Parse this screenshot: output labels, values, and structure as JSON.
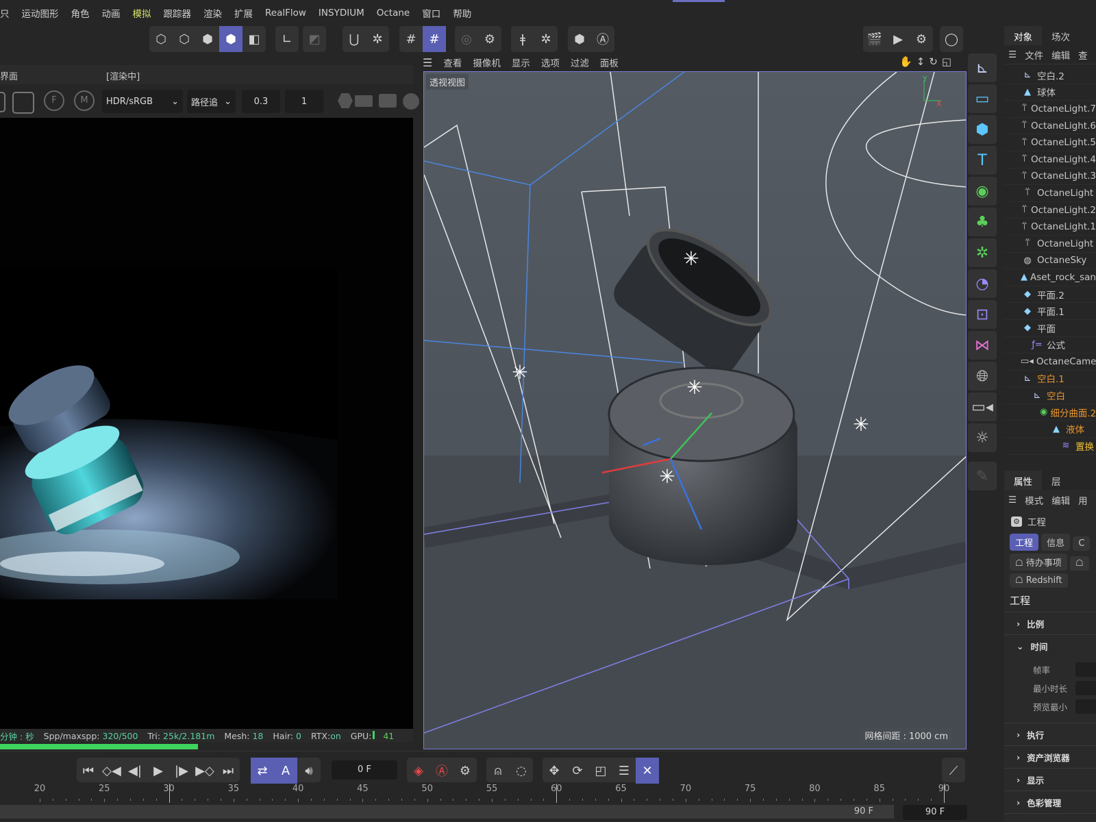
{
  "menu": [
    "只",
    "运动图形",
    "角色",
    "动画",
    "模拟",
    "跟踪器",
    "渲染",
    "扩展",
    "RealFlow",
    "INSYDIUM",
    "Octane",
    "窗口",
    "帮助"
  ],
  "menu_highlight": "模拟",
  "render_view": {
    "title": "界面",
    "status": "[渲染中]",
    "color_mode": "HDR/sRGB",
    "kernel": "路径追",
    "value1": "0.3",
    "value2": "1",
    "stats": {
      "time_label": "分钟 : 秒",
      "spp_label": "Spp/maxspp:",
      "spp": "320/500",
      "tri_label": "Tri:",
      "tri": "25k/2.181m",
      "mesh_label": "Mesh:",
      "mesh": "18",
      "hair_label": "Hair:",
      "hair": "0",
      "rtx_label": "RTX:",
      "rtx": "on",
      "gpu_label": "GPU:",
      "gpu": "41"
    },
    "progress": 0.48
  },
  "viewport": {
    "menu": [
      "查看",
      "摄像机",
      "显示",
      "选项",
      "过滤",
      "面板"
    ],
    "label": "透视视图",
    "grid_spacing": "网格间距 : 1000 cm",
    "axis_x": "X",
    "axis_y": "Y"
  },
  "object_manager": {
    "tabs": [
      "对象",
      "场次"
    ],
    "menu": [
      "文件",
      "编辑",
      "查"
    ],
    "items": [
      {
        "name": "空白.2",
        "icon": "null-icon",
        "depth": 0,
        "color": ""
      },
      {
        "name": "球体",
        "icon": "polygon-icon",
        "depth": 0,
        "color": ""
      },
      {
        "name": "OctaneLight.7",
        "icon": "light-icon",
        "depth": 0,
        "color": ""
      },
      {
        "name": "OctaneLight.6",
        "icon": "light-icon",
        "depth": 0,
        "color": ""
      },
      {
        "name": "OctaneLight.5",
        "icon": "light-icon",
        "depth": 0,
        "color": ""
      },
      {
        "name": "OctaneLight.4",
        "icon": "light-icon",
        "depth": 0,
        "color": ""
      },
      {
        "name": "OctaneLight.3",
        "icon": "light-icon",
        "depth": 0,
        "color": ""
      },
      {
        "name": "OctaneLight",
        "icon": "light-icon",
        "depth": 0,
        "color": ""
      },
      {
        "name": "OctaneLight.2",
        "icon": "light-icon",
        "depth": 0,
        "color": ""
      },
      {
        "name": "OctaneLight.1",
        "icon": "light-icon",
        "depth": 0,
        "color": ""
      },
      {
        "name": "OctaneLight",
        "icon": "light-icon",
        "depth": 0,
        "color": ""
      },
      {
        "name": "OctaneSky",
        "icon": "sky-icon",
        "depth": 0,
        "color": ""
      },
      {
        "name": "Aset_rock_sand",
        "icon": "polygon-icon",
        "depth": 0,
        "color": ""
      },
      {
        "name": "平面.2",
        "icon": "plane-icon",
        "depth": 0,
        "color": ""
      },
      {
        "name": "平面.1",
        "icon": "plane-icon",
        "depth": 0,
        "color": ""
      },
      {
        "name": "平面",
        "icon": "plane-icon",
        "depth": 0,
        "color": ""
      },
      {
        "name": "公式",
        "icon": "formula-icon",
        "depth": 1,
        "color": ""
      },
      {
        "name": "OctaneCamera",
        "icon": "camera-icon",
        "depth": 0,
        "color": ""
      },
      {
        "name": "空白.1",
        "icon": "null-icon",
        "depth": 0,
        "color": "orange"
      },
      {
        "name": "空白",
        "icon": "null-icon",
        "depth": 1,
        "color": "orange"
      },
      {
        "name": "细分曲面.2",
        "icon": "subdivision-icon",
        "depth": 2,
        "color": "orange"
      },
      {
        "name": "液体",
        "icon": "polygon-icon",
        "depth": 3,
        "color": "orange"
      },
      {
        "name": "置换",
        "icon": "displacer-icon",
        "depth": 4,
        "color": "yellow"
      }
    ]
  },
  "attributes": {
    "tabs": [
      "属性",
      "层"
    ],
    "menu": [
      "模式",
      "编辑",
      "用"
    ],
    "object": "工程",
    "buttons": [
      "工程",
      "信息",
      "C"
    ],
    "buttons2": [
      "待办事项",
      ""
    ],
    "buttons3": [
      "Redshift"
    ],
    "heading": "工程",
    "sections": [
      {
        "label": "比例",
        "open": false
      },
      {
        "label": "时间",
        "open": true,
        "props": [
          "帧率",
          "最小时长",
          "预览最小"
        ]
      },
      {
        "label": "执行",
        "open": false
      },
      {
        "label": "资产浏览器",
        "open": false
      },
      {
        "label": "显示",
        "open": false
      },
      {
        "label": "色彩管理",
        "open": false
      }
    ]
  },
  "timeline": {
    "current_frame": "0 F",
    "ticks": [
      "20",
      "25",
      "30",
      "35",
      "40",
      "45",
      "50",
      "55",
      "60",
      "65",
      "70",
      "75",
      "80",
      "85",
      "90"
    ],
    "end_frame": "90 F",
    "end_frame_field": "90 F"
  },
  "colors": {
    "accent": "#5a5fb4",
    "progress": "#3fd45e",
    "selected_orange": "#e8952e"
  }
}
